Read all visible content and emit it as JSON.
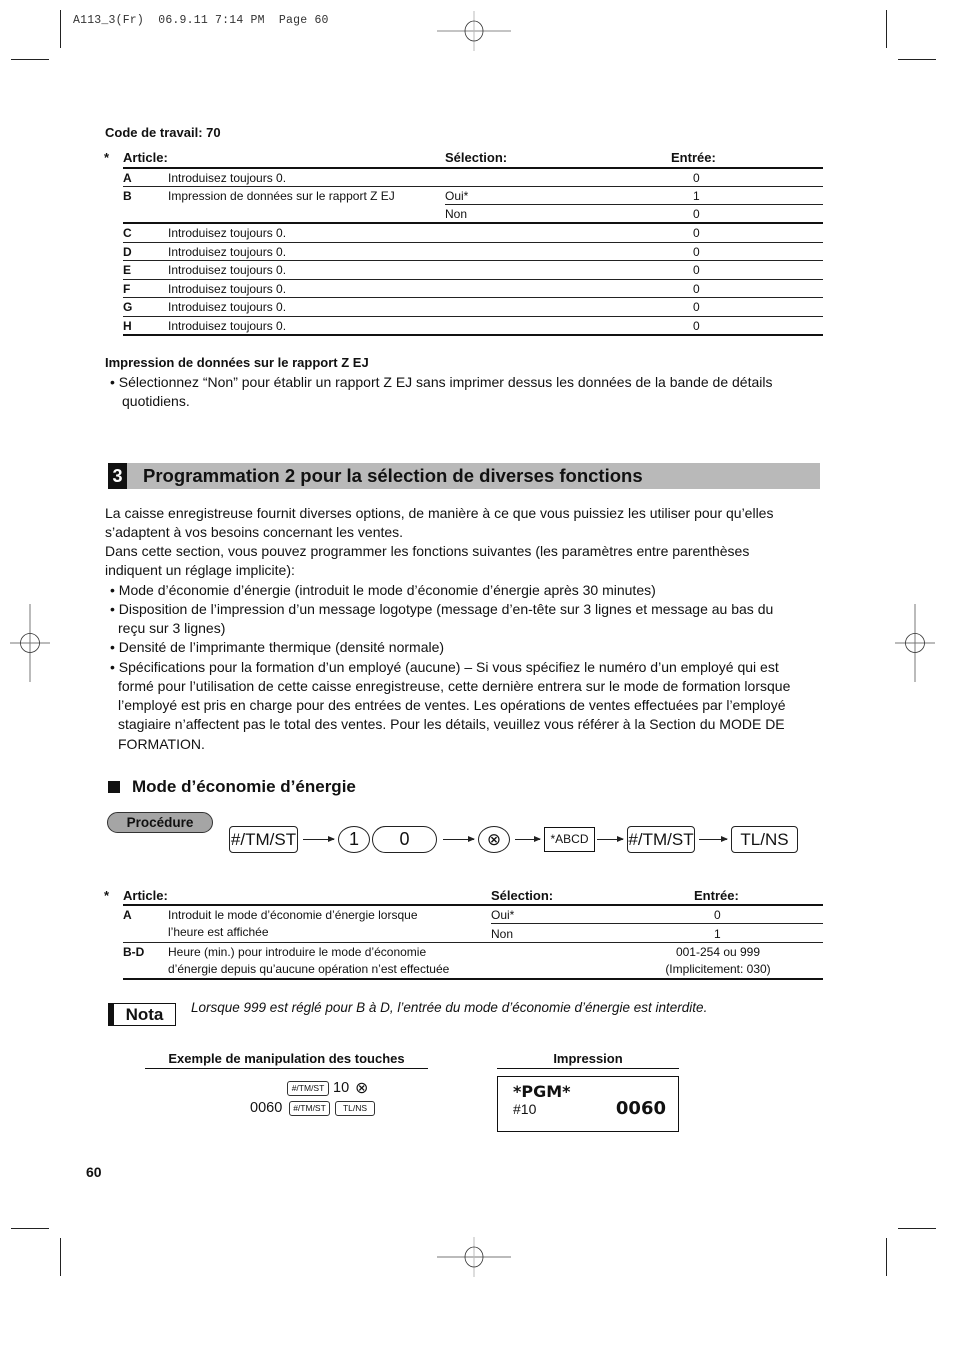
{
  "slug": {
    "text": "A113_3(Fr)  06.9.11 7:14 PM  Page 60"
  },
  "job_code": {
    "title": "Code de travail: 70"
  },
  "table1": {
    "asterisk": "*",
    "headers": {
      "article": "Article:",
      "selection": "Sélection:",
      "entry": "Entrée:"
    },
    "rows": [
      {
        "key": "A",
        "desc": "Introduisez toujours 0.",
        "options": [
          {
            "sel": "",
            "entry": "0"
          }
        ]
      },
      {
        "key": "B",
        "desc": "Impression de données sur le rapport Z EJ",
        "options": [
          {
            "sel": "Oui*",
            "entry": "1"
          },
          {
            "sel": "Non",
            "entry": "0"
          }
        ]
      },
      {
        "key": "C",
        "desc": "Introduisez toujours 0.",
        "options": [
          {
            "sel": "",
            "entry": "0"
          }
        ]
      },
      {
        "key": "D",
        "desc": "Introduisez toujours 0.",
        "options": [
          {
            "sel": "",
            "entry": "0"
          }
        ]
      },
      {
        "key": "E",
        "desc": "Introduisez toujours 0.",
        "options": [
          {
            "sel": "",
            "entry": "0"
          }
        ]
      },
      {
        "key": "F",
        "desc": "Introduisez toujours 0.",
        "options": [
          {
            "sel": "",
            "entry": "0"
          }
        ]
      },
      {
        "key": "G",
        "desc": "Introduisez toujours 0.",
        "options": [
          {
            "sel": "",
            "entry": "0"
          }
        ]
      },
      {
        "key": "H",
        "desc": "Introduisez toujours 0.",
        "options": [
          {
            "sel": "",
            "entry": "0"
          }
        ]
      }
    ]
  },
  "zej_note": {
    "title": "Impression de données sur le rapport Z EJ",
    "bullet": "• Sélectionnez “Non” pour établir un rapport Z EJ sans imprimer dessus les données de la bande de détails",
    "bullet_cont": "quotidiens."
  },
  "section": {
    "number": "3",
    "title": "Programmation 2 pour la sélection de diverses fonctions",
    "intro_lines": [
      "La caisse enregistreuse fournit diverses options, de manière à ce que vous puissiez les utiliser pour qu’elles",
      "s’adaptent à vos besoins concernant les ventes.",
      "Dans cette section, vous pouvez programmer les fonctions suivantes (les paramètres entre parenthèses",
      "indiquent un réglage implicite):"
    ],
    "bullets": [
      [
        "• Mode d’économie d’énergie (introduit le mode d’économie d’énergie après 30 minutes)"
      ],
      [
        "• Disposition de l’impression d’un message logotype (message d’en-tête sur 3 lignes et message au bas du",
        "reçu sur 3 lignes)"
      ],
      [
        "• Densité de l’imprimante thermique (densité normale)"
      ],
      [
        "• Spécifications pour la formation d’un employé (aucune) – Si vous spécifiez le numéro d’un employé qui est",
        "formé pour l’utilisation de cette caisse enregistreuse, cette dernière entrera sur le mode de formation lorsque",
        "l’employé est pris en charge pour des entrées de ventes. Les opérations de ventes effectuées par l’employé",
        "stagiaire n’affectent pas le total des ventes. Pour les détails, veuillez vous référer à la Section du MODE DE",
        "FORMATION."
      ]
    ]
  },
  "energy_mode": {
    "title": "Mode d’économie d’énergie",
    "procedure_label": "Procédure",
    "keys": {
      "tmst": "#/TM/ST",
      "one": "1",
      "zero": "0",
      "multiply_icon": "circled-x-icon",
      "multiply_glyph": "⊗",
      "abcd": "*ABCD",
      "tmst2": "#/TM/ST",
      "tlns": "TL/NS"
    }
  },
  "table2": {
    "asterisk": "*",
    "headers": {
      "article": "Article:",
      "selection": "Sélection:",
      "entry": "Entrée:"
    },
    "rows": [
      {
        "key": "A",
        "desc": [
          "Introduit le mode d’économie d’énergie lorsque",
          "l’heure est affichée"
        ],
        "options": [
          {
            "sel": "Oui*",
            "entry": "0"
          },
          {
            "sel": "Non",
            "entry": "1"
          }
        ]
      },
      {
        "key": "B-D",
        "desc": [
          "Heure (min.) pour introduire le mode d’économie",
          "d’énergie depuis qu’aucune opération n’est effectuée"
        ],
        "entry_lines": [
          "001-254 ou 999",
          "(Implicitement: 030)"
        ]
      }
    ]
  },
  "nota": {
    "label": "Nota",
    "text": "Lorsque 999 est réglé pour B à D, l’entrée du mode d’économie d’énergie est interdite."
  },
  "example": {
    "title": "Exemple de manipulation des touches",
    "line1": {
      "key1": "#/TM/ST",
      "value": "10",
      "glyph": "⊗"
    },
    "line2": {
      "value": "0060",
      "key1": "#/TM/ST",
      "key2": "TL/NS"
    }
  },
  "impression": {
    "title": "Impression",
    "line1": "*PGM*",
    "line2_left": "#10",
    "line2_right": "0060"
  },
  "footer": {
    "page_number": "60"
  }
}
